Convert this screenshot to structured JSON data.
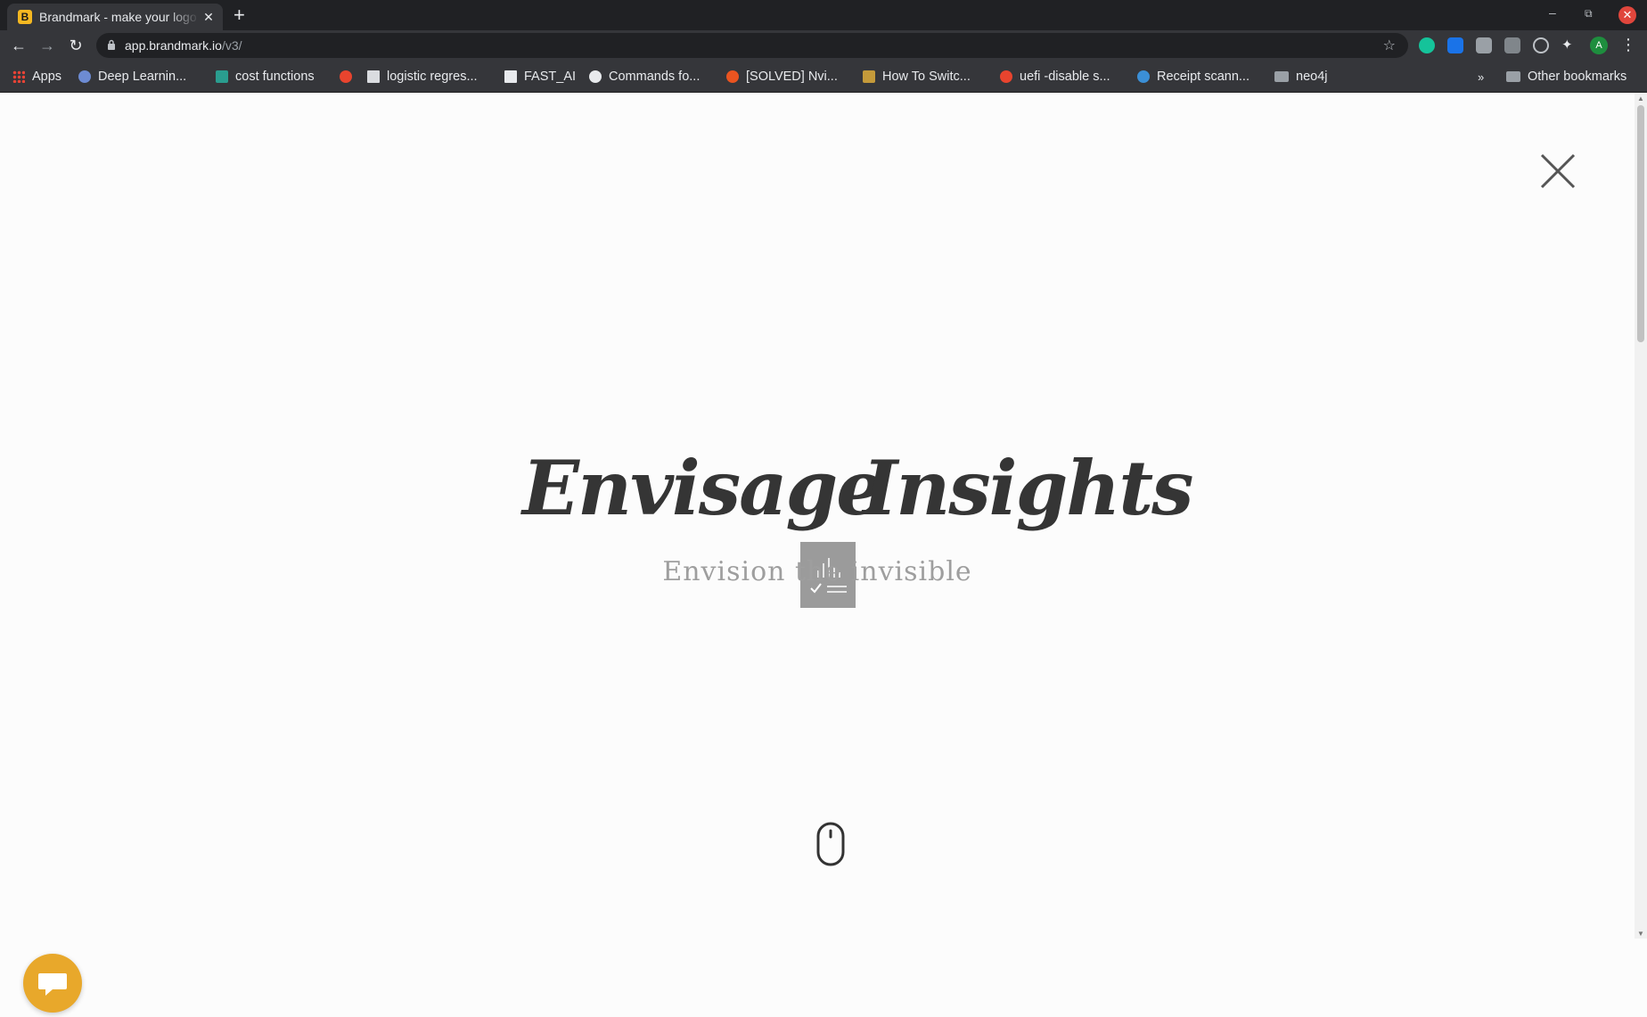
{
  "browser": {
    "tab_title": "Brandmark - make your logo",
    "tab_favicon_letter": "B",
    "url_host": "app.brandmark.io",
    "url_path": "/v3/",
    "profile_initial": "A",
    "bookmarks": [
      {
        "label": "Apps",
        "icon": "apps-grid-icon"
      },
      {
        "label": "Deep Learnin...",
        "icon": "brain-icon"
      },
      {
        "label": "cost functions",
        "icon": "chart-icon"
      },
      {
        "label": "",
        "icon": "ask-icon"
      },
      {
        "label": "logistic regres...",
        "icon": "page-icon"
      },
      {
        "label": "FAST_AI",
        "icon": "doc-icon"
      },
      {
        "label": "Commands fo...",
        "icon": "globe-icon"
      },
      {
        "label": "[SOLVED] Nvi...",
        "icon": "ubuntu-icon"
      },
      {
        "label": "How To Switc...",
        "icon": "site-icon"
      },
      {
        "label": "uefi -disable s...",
        "icon": "ask-icon"
      },
      {
        "label": "Receipt scann...",
        "icon": "wordpress-icon"
      },
      {
        "label": "neo4j",
        "icon": "folder-icon"
      }
    ],
    "overflow_label": "»",
    "other_bookmarks": "Other bookmarks"
  },
  "page": {
    "brand_word_1": "Envisage",
    "brand_word_2": "Insights",
    "tagline": "Envision the invisible",
    "colors": {
      "wordmark": "#353535",
      "mark": "#9b9b9b",
      "tagline": "#9e9e9e",
      "chat_button": "#e8a82b"
    }
  }
}
